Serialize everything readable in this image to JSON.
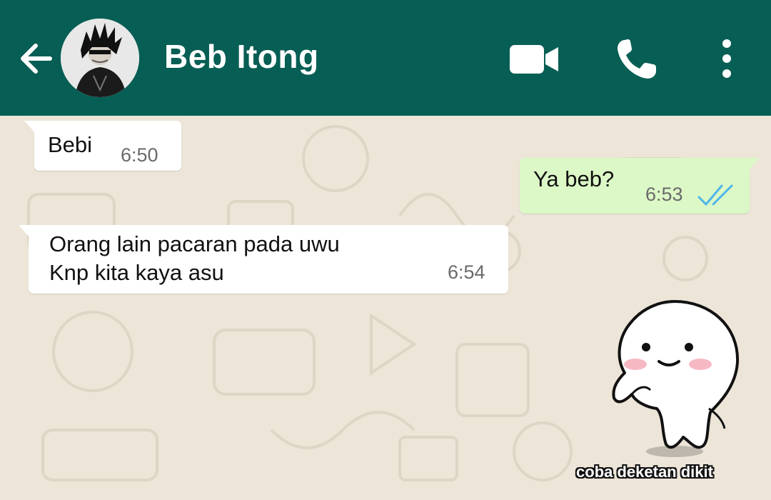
{
  "header": {
    "contact_name": "Beb Itong",
    "back_icon": "arrow-left-icon",
    "actions": [
      "video-call-icon",
      "phone-icon",
      "more-vert-icon"
    ],
    "color": "#075e54"
  },
  "messages": [
    {
      "direction": "incoming",
      "text": "Bebi",
      "time": "6:50"
    },
    {
      "direction": "outgoing",
      "text": "Ya beb?",
      "time": "6:53",
      "status": "read"
    },
    {
      "direction": "incoming",
      "text": "Orang lain pacaran pada uwu\nKnp kita kaya asu",
      "time": "6:54"
    }
  ],
  "sticker": {
    "caption": "coba deketan dikit"
  },
  "colors": {
    "incoming": "#ffffff",
    "outgoing": "#dcf8c6",
    "read_ticks": "#4fb6ec",
    "wallpaper": "#ece5d8"
  }
}
